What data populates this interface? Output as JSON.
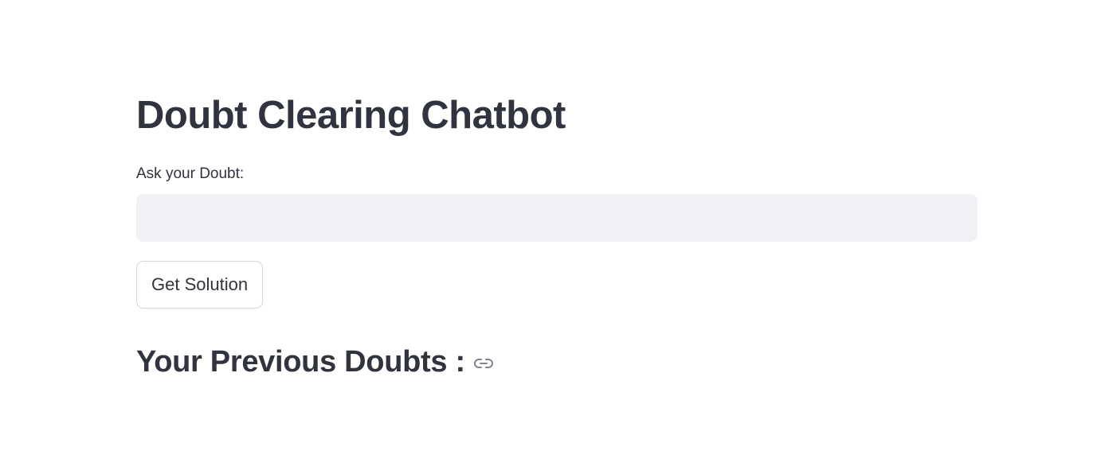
{
  "main": {
    "title": "Doubt Clearing Chatbot",
    "input_label": "Ask your Doubt:",
    "input_value": "",
    "input_placeholder": "",
    "submit_button_label": "Get Solution",
    "history_heading": "Your Previous Doubts :",
    "history_heading_icon": "link-icon"
  },
  "colors": {
    "text": "#31333f",
    "input_background": "#f0f2f6",
    "button_border": "#d6d6d9",
    "icon": "#808495"
  }
}
